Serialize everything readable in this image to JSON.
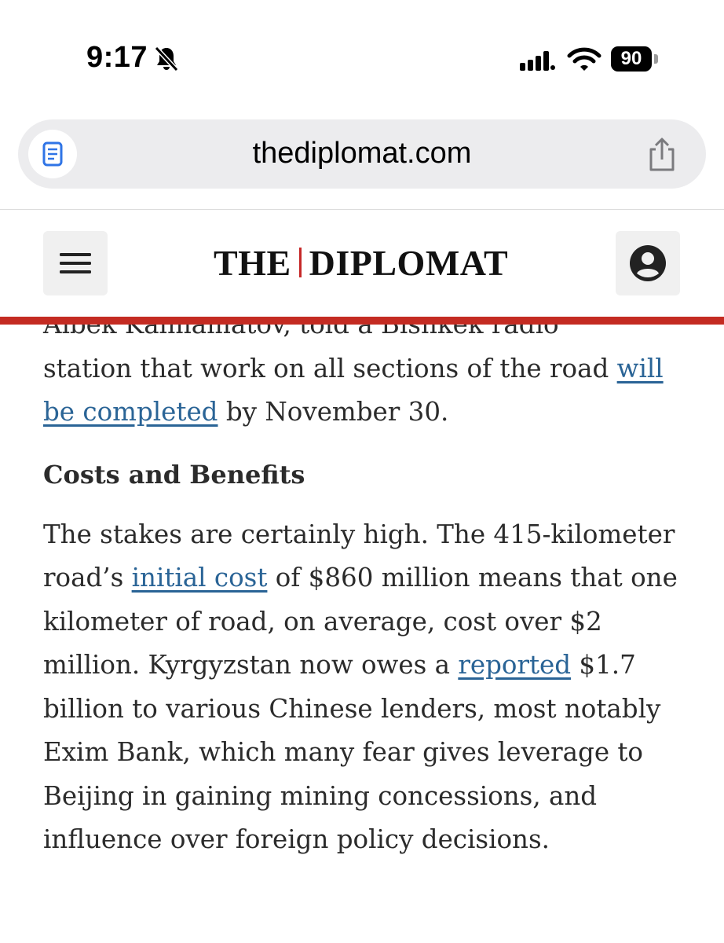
{
  "status_bar": {
    "time": "9:17",
    "battery": "90",
    "icons": [
      "bell-slash-icon",
      "cellular-signal-icon",
      "wifi-icon",
      "battery-icon"
    ]
  },
  "browser": {
    "url": "thediplomat.com",
    "icons": [
      "reader-mode-icon",
      "share-icon"
    ]
  },
  "site_header": {
    "logo_left": "THE",
    "logo_right": "DIPLOMAT",
    "accent_color": "#c42b22",
    "icons": [
      "hamburger-menu-icon",
      "account-icon"
    ]
  },
  "article": {
    "partial_line": "Aibek Kalmamatov, told a Bishkek radio",
    "para1_text": "station that work on all sections of the road",
    "para1_link": "will be completed",
    "para1_tail": " by November 30.",
    "heading": "Costs and Benefits",
    "para2_a": "The stakes are certainly high. The 415-kilometer road’s ",
    "para2_link1": "initial cost",
    "para2_b": " of $860 million means that one kilometer of road, on average, cost over $2 million. Kyrgyzstan now owes a ",
    "para2_link2": "reported",
    "para2_c": " $1.7 billion to various Chinese lenders, most notably Exim Bank, which many fear gives leverage to Beijing in gaining mining concessions, and influence over foreign policy decisions.",
    "link_color": "#2a6496"
  }
}
